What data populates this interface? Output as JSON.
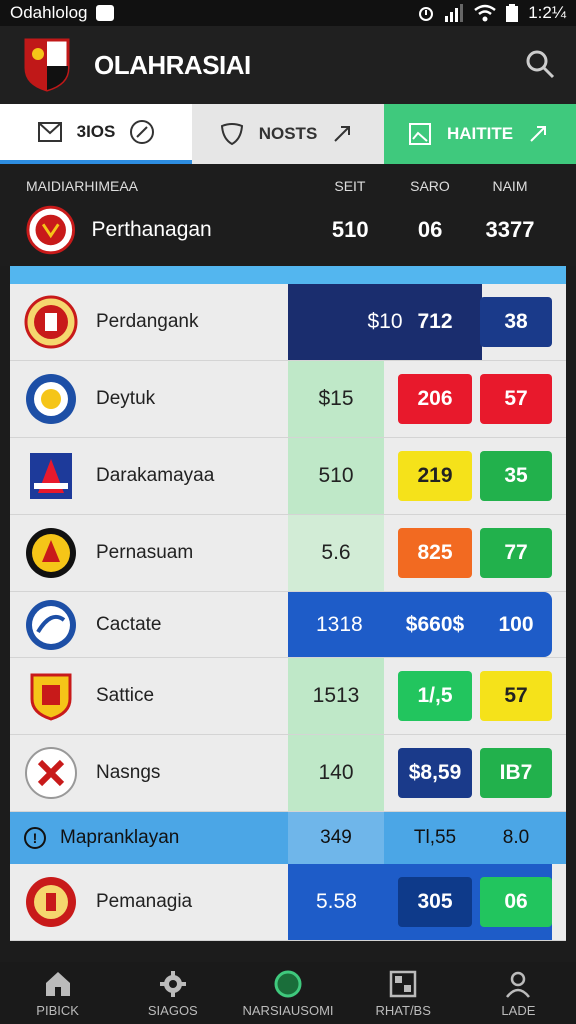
{
  "status_bar": {
    "carrier": "Odahlolog",
    "time": "1:2¼"
  },
  "app": {
    "title": "OLAHRASIAI",
    "colors": {
      "accent": "#3fc97d",
      "navy": "#1a2d6e",
      "blue": "#53b6ef"
    }
  },
  "tabs": [
    {
      "label": "3IOS",
      "icon": "mail-icon"
    },
    {
      "label": "NOSTS",
      "icon": "shield-icon"
    },
    {
      "label": "HAITITE",
      "icon": "image-icon"
    }
  ],
  "header": {
    "section_title": "MAIDIARHIMEAA",
    "col_labels": [
      "SEIT",
      "SARO",
      "NAIM"
    ],
    "featured": {
      "name": "Perthanagan",
      "values": [
        "510",
        "06",
        "3377"
      ]
    }
  },
  "rows": [
    {
      "name": "Perdangank",
      "values": [
        "$10",
        "712",
        "38"
      ]
    },
    {
      "name": "Deytuk",
      "values": [
        "$15",
        "206",
        "57"
      ]
    },
    {
      "name": "Darakamayaa",
      "values": [
        "510",
        "219",
        "35"
      ]
    },
    {
      "name": "Pernasuam",
      "values": [
        "5.6",
        "825",
        "77"
      ]
    },
    {
      "name": "Cactate",
      "values": [
        "1318",
        "$660$",
        "100"
      ]
    },
    {
      "name": "Sattice",
      "values": [
        "1513",
        "1/,5",
        "57"
      ]
    },
    {
      "name": "Nasngs",
      "values": [
        "140",
        "$8,59",
        "IB7"
      ]
    }
  ],
  "section": {
    "label": "Mapranklayan",
    "values": [
      "349",
      "Tl,55",
      "8.0"
    ]
  },
  "last_row": {
    "name": "Pemanagia",
    "values": [
      "5.58",
      "305",
      "06"
    ]
  },
  "bottom_nav": [
    {
      "label": "PIBICK",
      "icon": "home-icon"
    },
    {
      "label": "SIAGOS",
      "icon": "gear-icon"
    },
    {
      "label": "NARSIAUSOMI",
      "icon": "circle-icon"
    },
    {
      "label": "RHAT/BS",
      "icon": "grid-icon"
    },
    {
      "label": "LADE",
      "icon": "user-icon"
    }
  ]
}
